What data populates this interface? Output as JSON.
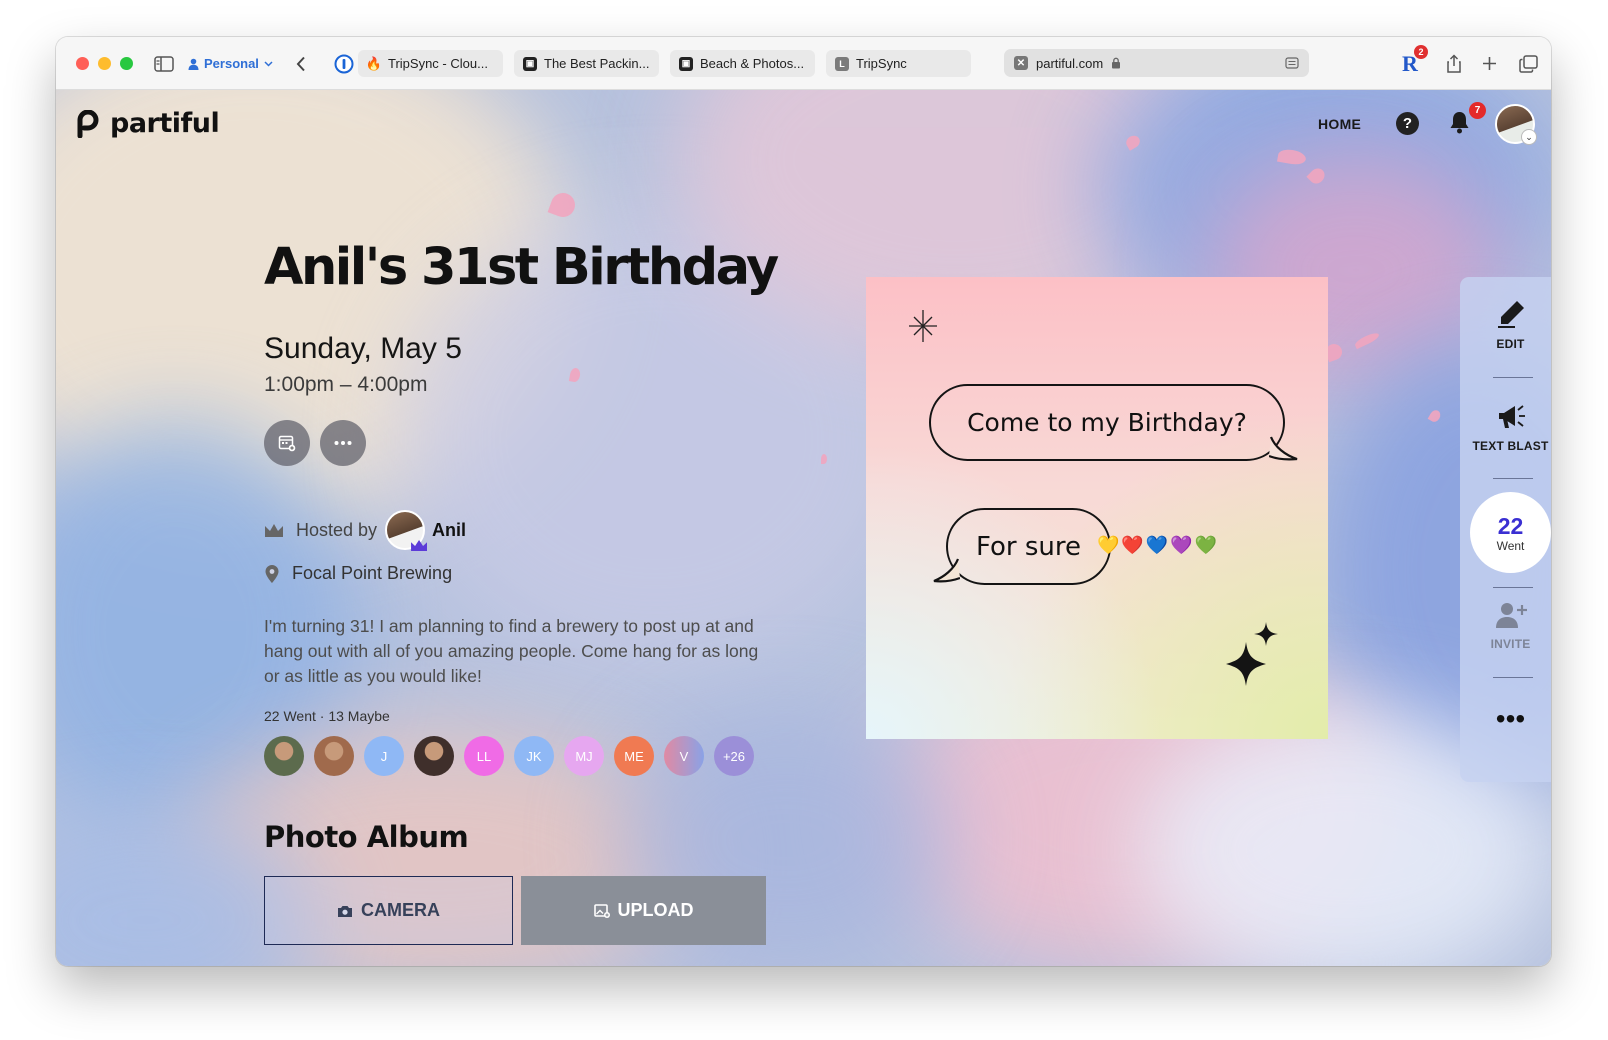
{
  "browser": {
    "profile": "Personal",
    "tabs": [
      {
        "title": "TripSync - Clou..."
      },
      {
        "title": "The Best Packin..."
      },
      {
        "title": "Beach & Photos..."
      },
      {
        "title": "TripSync"
      }
    ],
    "tab_favicon_letter": "L",
    "url": "partiful.com",
    "ext_badge": "2",
    "ext_letter": "R"
  },
  "nav": {
    "logo": "partiful",
    "home": "HOME",
    "help": "?",
    "notifications_count": "7"
  },
  "event": {
    "title": "Anil's 31st Birthday",
    "date": "Sunday, May 5",
    "time": "1:00pm – 4:00pm",
    "hosted_by_label": "Hosted by",
    "host_name": "Anil",
    "location": "Focal Point Brewing",
    "description": "I'm turning 31! I am planning to find a brewery to post up at and hang out with all of you amazing people. Come hang for as long or as little as you would like!",
    "guest_counts": "22 Went · 13 Maybe",
    "guests": [
      {
        "initials": "",
        "color": "#5c6b4d"
      },
      {
        "initials": "",
        "color": "#a06a4c"
      },
      {
        "initials": "J",
        "color": "#8fb8f5"
      },
      {
        "initials": "",
        "color": "#3f2f2b"
      },
      {
        "initials": "LL",
        "color": "#f06be6"
      },
      {
        "initials": "JK",
        "color": "#8fb8f5"
      },
      {
        "initials": "MJ",
        "color": "#e6a7f0"
      },
      {
        "initials": "ME",
        "color": "#f07a52"
      },
      {
        "initials": "V",
        "color": "#d6809a"
      },
      {
        "initials": "+26",
        "color": "#9b8fd8"
      }
    ]
  },
  "album": {
    "title": "Photo Album",
    "camera": "CAMERA",
    "upload": "UPLOAD"
  },
  "card": {
    "bubble1": "Come to my Birthday?",
    "bubble2": "For sure",
    "hearts": "💛❤️💙💜💚"
  },
  "actions": {
    "edit": "EDIT",
    "text_blast": "TEXT BLAST",
    "went_count": "22",
    "went_label": "Went",
    "invite": "INVITE",
    "more": "•••"
  },
  "colors": {
    "accent": "#3a2fd2",
    "profile_blue": "#2f6fd6"
  }
}
